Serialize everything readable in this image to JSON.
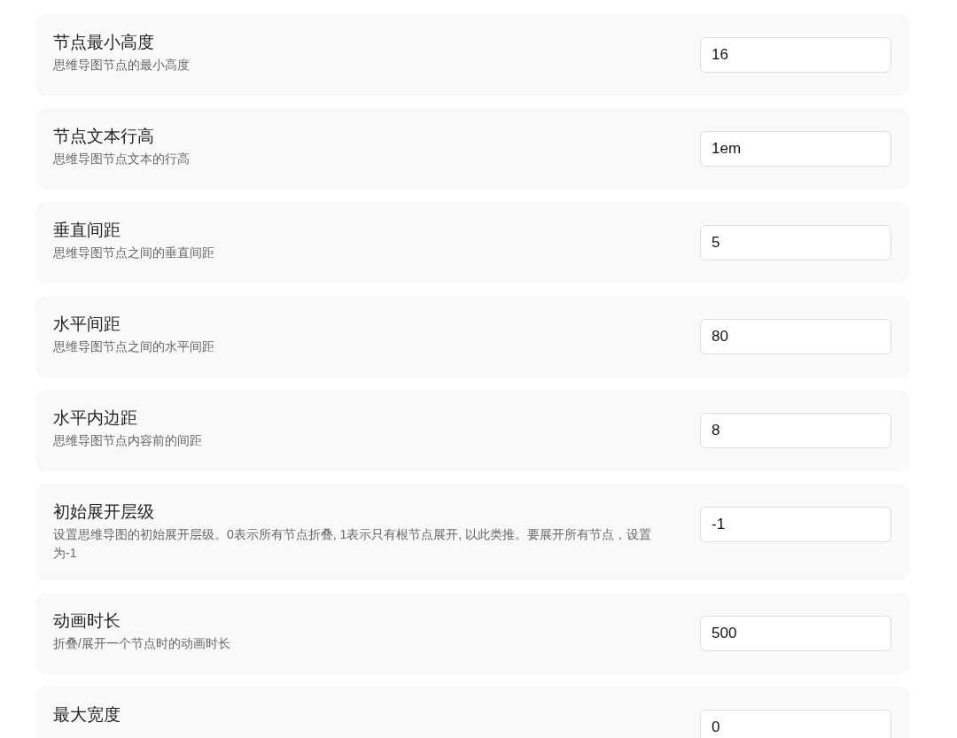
{
  "settings": [
    {
      "title": "节点最小高度",
      "description": "思维导图节点的最小高度",
      "value": "16"
    },
    {
      "title": "节点文本行高",
      "description": "思维导图节点文本的行高",
      "value": "1em"
    },
    {
      "title": "垂直间距",
      "description": "思维导图节点之间的垂直间距",
      "value": "5"
    },
    {
      "title": "水平间距",
      "description": "思维导图节点之间的水平间距",
      "value": "80"
    },
    {
      "title": "水平内边距",
      "description": "思维导图节点内容前的间距",
      "value": "8"
    },
    {
      "title": "初始展开层级",
      "description": "设置思维导图的初始展开层级。0表示所有节点折叠, 1表示只有根节点展开, 以此类推。要展开所有节点，设置为-1",
      "value": "-1"
    },
    {
      "title": "动画时长",
      "description": "折叠/展开一个节点时的动画时长",
      "value": "500"
    },
    {
      "title": "最大宽度",
      "value": "0"
    }
  ]
}
